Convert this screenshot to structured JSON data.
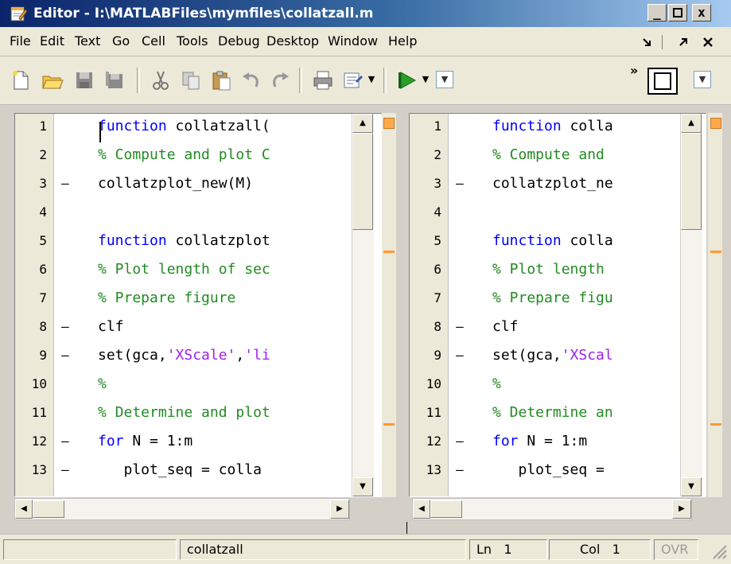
{
  "window": {
    "title": "Editor - I:\\MATLABFiles\\mymfiles\\collatzall.m",
    "buttons": [
      "_",
      "□",
      "x"
    ]
  },
  "menu": {
    "items": [
      {
        "label": "File"
      },
      {
        "label": "Edit"
      },
      {
        "label": "Text"
      },
      {
        "label": "Go"
      },
      {
        "label": "Cell"
      },
      {
        "label": "Tools"
      },
      {
        "label": "Debug"
      },
      {
        "label": "Desktop"
      },
      {
        "label": "Window"
      },
      {
        "label": "Help"
      }
    ],
    "right_icons": [
      "dock-icon",
      "undock-icon",
      "close-doc-icon"
    ]
  },
  "toolbar": {
    "icons": [
      "new-file-icon",
      "open-folder-icon",
      "save-icon",
      "save-all-icon",
      "cut-icon",
      "copy-icon",
      "paste-icon",
      "undo-icon",
      "redo-icon",
      "print-icon",
      "find-icon",
      "run-icon",
      "stack-icon",
      "layout-icon"
    ],
    "overflow": "»"
  },
  "editor": {
    "panes": [
      {
        "lines": [
          {
            "n": "1",
            "dash": "",
            "tokens": [
              {
                "t": "kw",
                "v": "function "
              },
              {
                "t": "tx",
                "v": "collatzall("
              }
            ]
          },
          {
            "n": "2",
            "dash": "",
            "tokens": [
              {
                "t": "cm",
                "v": "% Compute and plot C"
              }
            ]
          },
          {
            "n": "3",
            "dash": "–",
            "tokens": [
              {
                "t": "tx",
                "v": "collatzplot_new(M)"
              }
            ]
          },
          {
            "n": "4",
            "dash": "",
            "tokens": []
          },
          {
            "n": "5",
            "dash": "",
            "tokens": [
              {
                "t": "kw",
                "v": "function "
              },
              {
                "t": "tx",
                "v": "collatzplot"
              }
            ]
          },
          {
            "n": "6",
            "dash": "",
            "tokens": [
              {
                "t": "cm",
                "v": "% Plot length of sec"
              }
            ]
          },
          {
            "n": "7",
            "dash": "",
            "tokens": [
              {
                "t": "cm",
                "v": "% Prepare figure"
              }
            ]
          },
          {
            "n": "8",
            "dash": "–",
            "tokens": [
              {
                "t": "tx",
                "v": "clf"
              }
            ]
          },
          {
            "n": "9",
            "dash": "–",
            "tokens": [
              {
                "t": "tx",
                "v": "set(gca,"
              },
              {
                "t": "st",
                "v": "'XScale'"
              },
              {
                "t": "tx",
                "v": ","
              },
              {
                "t": "st",
                "v": "'li"
              }
            ]
          },
          {
            "n": "10",
            "dash": "",
            "tokens": [
              {
                "t": "cm",
                "v": "%"
              }
            ]
          },
          {
            "n": "11",
            "dash": "",
            "tokens": [
              {
                "t": "cm",
                "v": "% Determine and plot"
              }
            ]
          },
          {
            "n": "12",
            "dash": "–",
            "tokens": [
              {
                "t": "kw",
                "v": "for "
              },
              {
                "t": "tx",
                "v": "N = 1:m"
              }
            ]
          },
          {
            "n": "13",
            "dash": "–",
            "tokens": [
              {
                "t": "tx",
                "v": "   plot_seq = colla"
              }
            ]
          }
        ]
      },
      {
        "lines": [
          {
            "n": "1",
            "dash": "",
            "tokens": [
              {
                "t": "kw",
                "v": "function "
              },
              {
                "t": "tx",
                "v": "colla"
              }
            ]
          },
          {
            "n": "2",
            "dash": "",
            "tokens": [
              {
                "t": "cm",
                "v": "% Compute and"
              }
            ]
          },
          {
            "n": "3",
            "dash": "–",
            "tokens": [
              {
                "t": "tx",
                "v": "collatzplot_ne"
              }
            ]
          },
          {
            "n": "4",
            "dash": "",
            "tokens": []
          },
          {
            "n": "5",
            "dash": "",
            "tokens": [
              {
                "t": "kw",
                "v": "function "
              },
              {
                "t": "tx",
                "v": "colla"
              }
            ]
          },
          {
            "n": "6",
            "dash": "",
            "tokens": [
              {
                "t": "cm",
                "v": "% Plot length"
              }
            ]
          },
          {
            "n": "7",
            "dash": "",
            "tokens": [
              {
                "t": "cm",
                "v": "% Prepare figu"
              }
            ]
          },
          {
            "n": "8",
            "dash": "–",
            "tokens": [
              {
                "t": "tx",
                "v": "clf"
              }
            ]
          },
          {
            "n": "9",
            "dash": "–",
            "tokens": [
              {
                "t": "tx",
                "v": "set(gca,"
              },
              {
                "t": "st",
                "v": "'XScal"
              }
            ]
          },
          {
            "n": "10",
            "dash": "",
            "tokens": [
              {
                "t": "cm",
                "v": "%"
              }
            ]
          },
          {
            "n": "11",
            "dash": "",
            "tokens": [
              {
                "t": "cm",
                "v": "% Determine an"
              }
            ]
          },
          {
            "n": "12",
            "dash": "–",
            "tokens": [
              {
                "t": "kw",
                "v": "for "
              },
              {
                "t": "tx",
                "v": "N = 1:m"
              }
            ]
          },
          {
            "n": "13",
            "dash": "–",
            "tokens": [
              {
                "t": "tx",
                "v": "   plot_seq ="
              }
            ]
          }
        ]
      }
    ]
  },
  "status": {
    "function_name": "collatzall",
    "ln_label": "Ln",
    "ln_value": "1",
    "col_label": "Col",
    "col_value": "1",
    "ovr": "OVR"
  },
  "colors": {
    "keyword": "#0000ff",
    "comment": "#228b22",
    "string": "#a020f0",
    "warning": "#ff9933"
  }
}
